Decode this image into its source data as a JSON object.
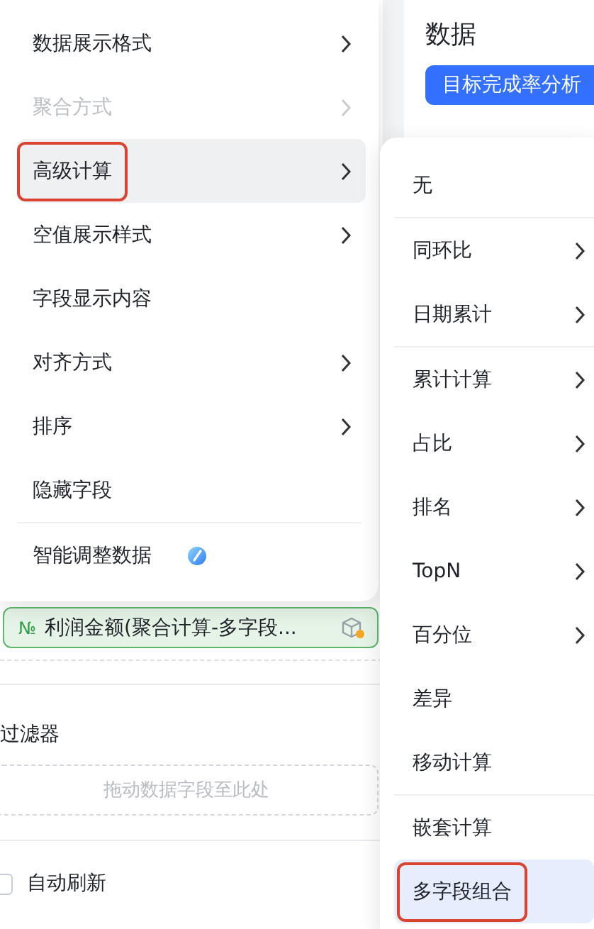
{
  "panel": {
    "title": "数据",
    "tag": "目标完成率分析"
  },
  "field_pill": {
    "type_icon": "№",
    "label": "利润金额(聚合计算-多字段..."
  },
  "filter": {
    "title": "过滤器",
    "placeholder": "拖动数据字段至此处"
  },
  "auto_refresh": {
    "label": "自动刷新",
    "checked": false
  },
  "menu": [
    {
      "kind": "item",
      "label": "数据展示格式",
      "submenu": true,
      "disabled": false,
      "selected": false,
      "highlighted": false
    },
    {
      "kind": "item",
      "label": "聚合方式",
      "submenu": true,
      "disabled": true,
      "selected": false,
      "highlighted": false
    },
    {
      "kind": "item",
      "label": "高级计算",
      "submenu": true,
      "disabled": false,
      "selected": true,
      "highlighted": true
    },
    {
      "kind": "item",
      "label": "空值展示样式",
      "submenu": true,
      "disabled": false,
      "selected": false,
      "highlighted": false
    },
    {
      "kind": "item",
      "label": "字段显示内容",
      "submenu": false,
      "disabled": false,
      "selected": false,
      "highlighted": false
    },
    {
      "kind": "item",
      "label": "对齐方式",
      "submenu": true,
      "disabled": false,
      "selected": false,
      "highlighted": false
    },
    {
      "kind": "item",
      "label": "排序",
      "submenu": true,
      "disabled": false,
      "selected": false,
      "highlighted": false
    },
    {
      "kind": "item",
      "label": "隐藏字段",
      "submenu": false,
      "disabled": false,
      "selected": false,
      "highlighted": false
    },
    {
      "kind": "divider"
    },
    {
      "kind": "icon-item",
      "label": "智能调整数据",
      "submenu": false,
      "disabled": false,
      "selected": false,
      "highlighted": false
    }
  ],
  "submenu": [
    {
      "kind": "item",
      "label": "无",
      "submenu": false,
      "disabled": false,
      "selected": false,
      "highlighted": false
    },
    {
      "kind": "divider"
    },
    {
      "kind": "item",
      "label": "同环比",
      "submenu": true,
      "disabled": false,
      "selected": false,
      "highlighted": false
    },
    {
      "kind": "item",
      "label": "日期累计",
      "submenu": true,
      "disabled": false,
      "selected": false,
      "highlighted": false
    },
    {
      "kind": "divider"
    },
    {
      "kind": "item",
      "label": "累计计算",
      "submenu": true,
      "disabled": false,
      "selected": false,
      "highlighted": false
    },
    {
      "kind": "item",
      "label": "占比",
      "submenu": true,
      "disabled": false,
      "selected": false,
      "highlighted": false
    },
    {
      "kind": "item",
      "label": "排名",
      "submenu": true,
      "disabled": false,
      "selected": false,
      "highlighted": false
    },
    {
      "kind": "item",
      "label": "TopN",
      "submenu": true,
      "disabled": false,
      "selected": false,
      "highlighted": false
    },
    {
      "kind": "item",
      "label": "百分位",
      "submenu": true,
      "disabled": false,
      "selected": false,
      "highlighted": false
    },
    {
      "kind": "item",
      "label": "差异",
      "submenu": false,
      "disabled": false,
      "selected": false,
      "highlighted": false
    },
    {
      "kind": "item",
      "label": "移动计算",
      "submenu": false,
      "disabled": false,
      "selected": false,
      "highlighted": false
    },
    {
      "kind": "divider"
    },
    {
      "kind": "item",
      "label": "嵌套计算",
      "submenu": false,
      "disabled": false,
      "selected": false,
      "highlighted": false
    },
    {
      "kind": "item",
      "label": "多字段组合",
      "submenu": false,
      "disabled": false,
      "selected": true,
      "highlighted": true
    }
  ]
}
